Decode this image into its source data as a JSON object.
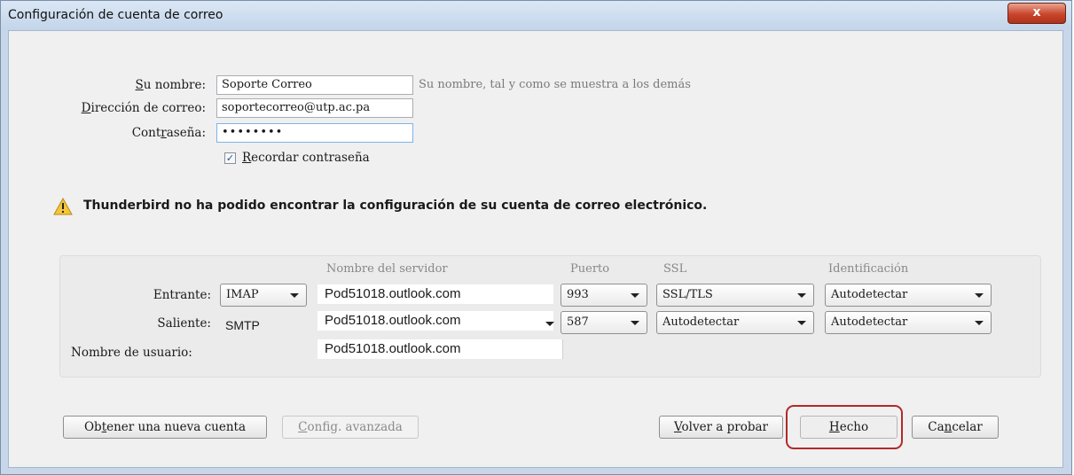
{
  "window": {
    "title": "Configuración de cuenta de correo",
    "close_label": "x"
  },
  "form": {
    "name_label_pre": "",
    "name_label_key": "S",
    "name_label_post": "u nombre:",
    "name_value": "Soporte Correo",
    "name_hint": "Su nombre, tal y como se muestra a los demás",
    "email_label_key": "D",
    "email_label_post": "irección de correo:",
    "email_value": "soportecorreo@utp.ac.pa",
    "password_label_pre": "Cont",
    "password_label_key": "r",
    "password_label_post": "aseña:",
    "password_value": "••••••••",
    "remember_key": "R",
    "remember_post": "ecordar contraseña",
    "remember_checked": true
  },
  "warning": {
    "icon": "warning-triangle-icon",
    "text": "Thunderbird no ha podido encontrar la configuración de su cuenta de correo electrónico."
  },
  "server_table": {
    "headers": {
      "server": "Nombre del servidor",
      "port": "Puerto",
      "ssl": "SSL",
      "auth": "Identificación"
    },
    "incoming": {
      "label": "Entrante:",
      "protocol": "IMAP",
      "server": "Pod51018.outlook.com",
      "port": "993",
      "ssl": "SSL/TLS",
      "auth": "Autodetectar"
    },
    "outgoing": {
      "label": "Saliente:",
      "protocol": "SMTP",
      "server": "Pod51018.outlook.com",
      "port": "587",
      "ssl": "Autodetectar",
      "auth": "Autodetectar"
    },
    "username": {
      "label": "Nombre de usuario:",
      "value": "Pod51018.outlook.com"
    }
  },
  "buttons": {
    "new_account_pre": "Ob",
    "new_account_key": "t",
    "new_account_post": "ener una nueva cuenta",
    "advanced_key": "C",
    "advanced_post": "onfig. avanzada",
    "retest_key": "V",
    "retest_post": "olver a probar",
    "done_key": "H",
    "done_post": "echo",
    "cancel_pre": "Ca",
    "cancel_key": "n",
    "cancel_post": "celar"
  },
  "colors": {
    "highlight": "#b22a2a",
    "titlebar": "#c7d7e9",
    "close": "#c8452b"
  }
}
